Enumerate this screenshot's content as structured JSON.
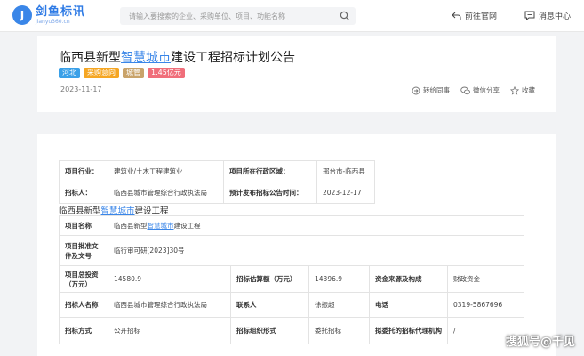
{
  "header": {
    "logo_mark": "J",
    "logo_name": "剑鱼标讯",
    "logo_domain": "jianyu360.cn",
    "search_placeholder": "请输入要搜索的企业、采购单位、项目、功能名称",
    "goto_official": "前往官网",
    "message_center": "消息中心"
  },
  "notice": {
    "title_prefix": "临西县新型",
    "title_highlight": "智慧城市",
    "title_suffix": "建设工程招标计划公告",
    "tags": [
      {
        "label": "河北",
        "color": "#3aa0e8"
      },
      {
        "label": "采购意向",
        "color": "#f5a623"
      },
      {
        "label": "城管",
        "color": "#c9a36a"
      },
      {
        "label": "1.45亿元",
        "color": "#f06e7a"
      }
    ],
    "date": "2023-11-17",
    "actions": {
      "forward": "转给同事",
      "wechat_share": "微信分享",
      "favorite": "收藏"
    }
  },
  "info": {
    "industry_label": "项目行业：",
    "industry_value": "建筑业/土木工程建筑业",
    "region_label": "项目所在行政区域：",
    "region_value": "邢台市-临西县",
    "tenderer_label": "招标人：",
    "tenderer_value": "临西县城市管理综合行政执法局",
    "expected_date_label": "预计发布招标公告时间：",
    "expected_date_value": "2023-12-17"
  },
  "project": {
    "subtitle_prefix": "临西县新型",
    "subtitle_highlight": "智慧城市",
    "subtitle_suffix": "建设工程",
    "name_label": "项目名称",
    "name_prefix": "临西县新型",
    "name_highlight": "智慧城市",
    "name_suffix": "建设工程",
    "approval_label": "项目批准文件及文号",
    "approval_value": "临行审可研[2023]30号",
    "investment_label": "项目总投资（万元）",
    "investment_value": "14580.9",
    "estimate_label": "招标估算额（万元）",
    "estimate_value": "14396.9",
    "fund_label": "资金来源及构成",
    "fund_value": "财政资金",
    "tenderer_name_label": "招标人名称",
    "tenderer_name_value": "临西县城市管理综合行政执法局",
    "contact_label": "联系人",
    "contact_value": "徐振超",
    "phone_label": "电话",
    "phone_value": "0319-5867696",
    "method_label": "招标方式",
    "method_value": "公开招标",
    "org_form_label": "招标组织形式",
    "org_form_value": "委托招标",
    "agency_label": "拟委托的招标代理机构",
    "agency_value": "/"
  },
  "watermark": "搜狐号@千见"
}
